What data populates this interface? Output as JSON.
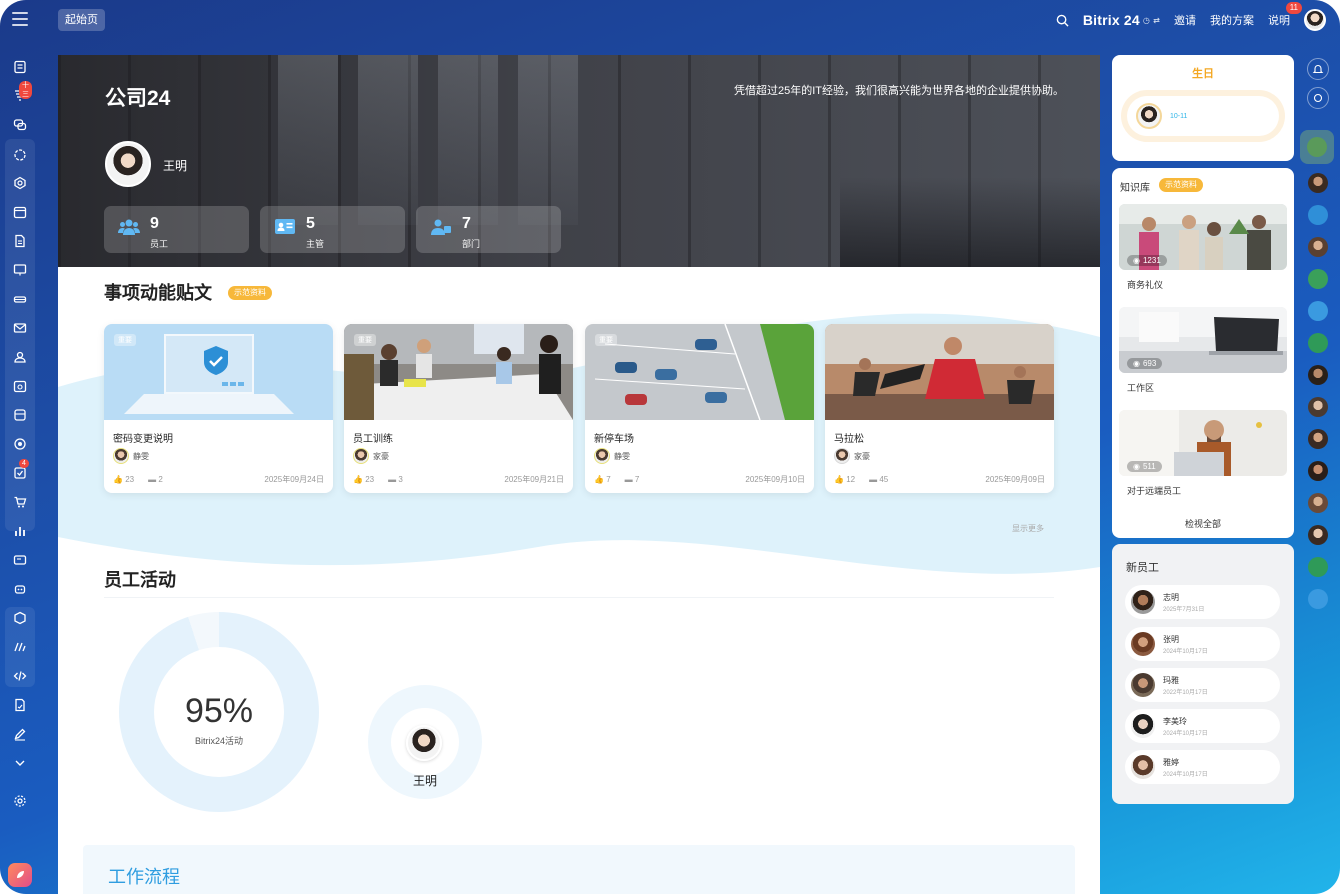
{
  "topbar": {
    "home_label": "起始页",
    "brand": "Bitrix 24",
    "invite_label": "邀请",
    "plan_label": "我的方案",
    "help_label": "说明",
    "help_badge": "11"
  },
  "leftbar": {
    "badges": {
      "feed": "十三",
      "tasks": "4"
    },
    "icons": [
      "news-icon",
      "feed-icon",
      "chat-icon",
      "copilot-icon",
      "workspace-icon",
      "calendar-icon",
      "docs-icon",
      "boards-icon",
      "drive-icon",
      "mail-icon",
      "groups-icon",
      "schedule-icon",
      "crm-icon",
      "marketing-icon",
      "tasks-icon",
      "shop-icon",
      "analytics-icon",
      "sign-icon",
      "automation-icon",
      "store-icon",
      "sites-icon",
      "developer-icon",
      "doc-sign-icon",
      "edit-icon",
      "more-icon",
      "settings-icon",
      "rocket-icon"
    ]
  },
  "hero": {
    "company": "公司24",
    "slogan": "凭借超过25年的IT经验，我们很高兴能为世界各地的企业提供协助。",
    "user_name": "王明",
    "stats": [
      {
        "num": "9",
        "label": "员工"
      },
      {
        "num": "5",
        "label": "主管"
      },
      {
        "num": "7",
        "label": "部门"
      }
    ]
  },
  "posts": {
    "title": "事项动能贴文",
    "tag": "示范资料",
    "show_more": "显示更多",
    "cards": [
      {
        "pin": "重要",
        "title": "密码变更说明",
        "author": "静雯",
        "likes": "23",
        "comments": "2",
        "date": "2025年09月24日"
      },
      {
        "pin": "重要",
        "title": "员工训练",
        "author": "家豪",
        "likes": "23",
        "comments": "3",
        "date": "2025年09月21日"
      },
      {
        "pin": "重要",
        "title": "新停车场",
        "author": "静雯",
        "likes": "7",
        "comments": "7",
        "date": "2025年09月10日"
      },
      {
        "pin": "",
        "title": "马拉松",
        "author": "家豪",
        "likes": "12",
        "comments": "45",
        "date": "2025年09月09日"
      }
    ]
  },
  "activity": {
    "title": "员工活动",
    "percent_text": "95%",
    "percent_value": 95,
    "percent_label": "Bitrix24活动",
    "top_user": "王明"
  },
  "workflow": {
    "title": "工作流程"
  },
  "birthday": {
    "title": "生日",
    "date": "10-11"
  },
  "knowledge": {
    "title": "知识库",
    "tag": "示范资料",
    "items": [
      {
        "views": "1231",
        "label": "商务礼仪"
      },
      {
        "views": "693",
        "label": "工作区"
      },
      {
        "views": "511",
        "label": "对于远端员工"
      }
    ],
    "view_all": "检视全部"
  },
  "new_employees": {
    "title": "新员工",
    "items": [
      {
        "name": "志明",
        "date": "2025年7月31日"
      },
      {
        "name": "张明",
        "date": "2024年10月17日"
      },
      {
        "name": "玛雅",
        "date": "2022年10月17日"
      },
      {
        "name": "李美玲",
        "date": "2024年10月17日"
      },
      {
        "name": "雅婷",
        "date": "2024年10月17日"
      }
    ]
  },
  "colors": {
    "accent": "#2f9de0",
    "tag": "#f7b83a",
    "badge": "#f0483e",
    "birthday": "#f4a823"
  }
}
